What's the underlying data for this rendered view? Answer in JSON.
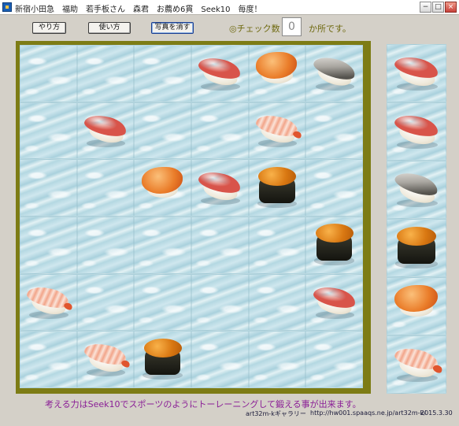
{
  "window": {
    "title": "新宿小田急　福助　若手板さん　森君　お薦め6貫　Seek10　毎度！",
    "controls": {
      "minimize": "−",
      "maximize": "□",
      "close": "×"
    }
  },
  "toolbar": {
    "buttons": [
      {
        "label": "やり方",
        "name": "how-to-button"
      },
      {
        "label": "使い方",
        "name": "usage-button"
      },
      {
        "label": "写真を消す",
        "name": "clear-photos-button"
      }
    ],
    "check_label": "◎チェック数",
    "check_count": "0",
    "check_suffix": "か所です。"
  },
  "board": {
    "rows": [
      [
        "empty",
        "empty",
        "empty",
        "maguro",
        "akagai",
        "aji"
      ],
      [
        "empty",
        "maguro",
        "empty",
        "empty",
        "ebi",
        "empty"
      ],
      [
        "empty",
        "empty",
        "akagai",
        "maguro",
        "uni",
        "empty"
      ],
      [
        "empty",
        "empty",
        "empty",
        "empty",
        "empty",
        "uni"
      ],
      [
        "ebi",
        "empty",
        "empty",
        "empty",
        "empty",
        "maguro"
      ],
      [
        "empty",
        "ebi",
        "uni",
        "empty",
        "empty",
        "empty"
      ]
    ]
  },
  "reference": {
    "items": [
      "maguro",
      "maguro",
      "aji",
      "uni",
      "akagai",
      "ebi"
    ]
  },
  "sushi_colors": {
    "maguro": "#d8544a",
    "ebi": "#f2a58a",
    "aji": "#a9a6a0",
    "uni": "#e08a20",
    "akagai": "#e8742a"
  },
  "footer": {
    "message": "考える力はSeek10でスポーツのようにトーレーニングして鍛える事が出来ます。",
    "credit": "art32m-kギャラリー",
    "url": "http://hw001.spaaqs.ne.jp/art32m-k/",
    "date": "2015.3.30"
  }
}
